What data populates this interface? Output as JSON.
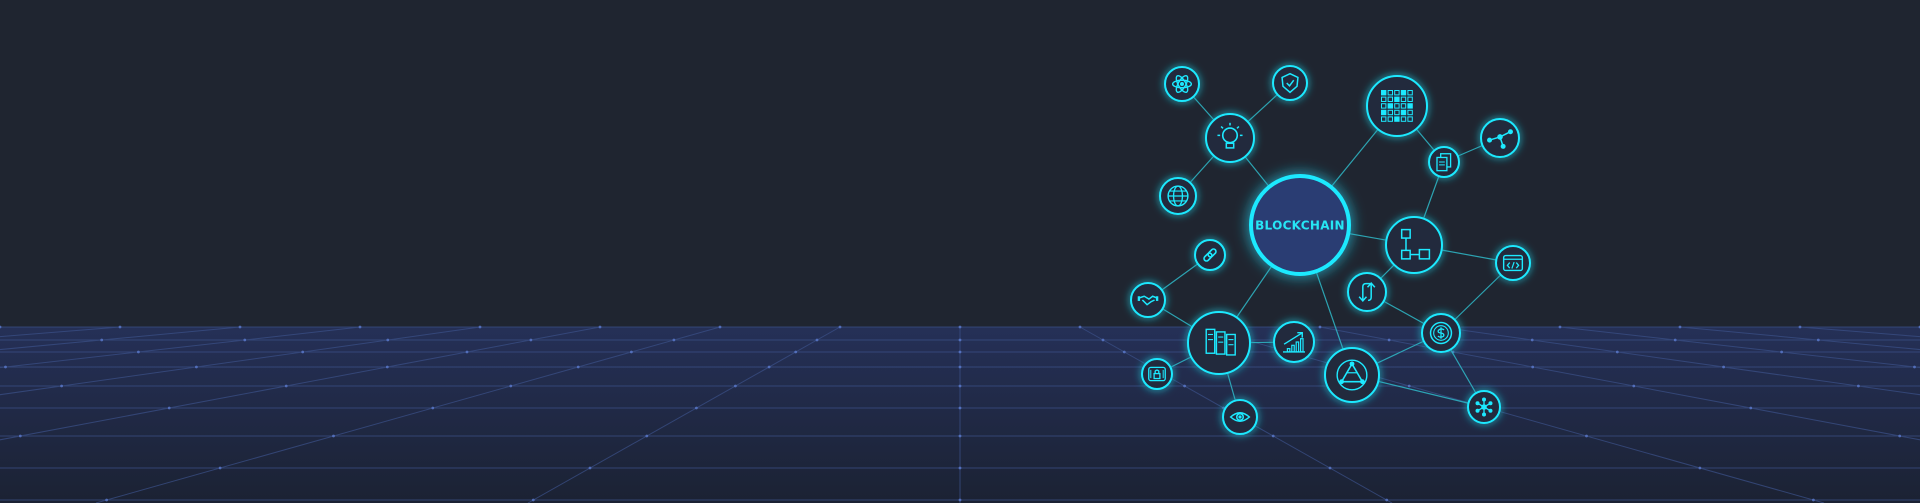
{
  "hub": {
    "label": "BLOCKCHAIN"
  },
  "colors": {
    "background": "#1f2530",
    "floor": "#1d2538",
    "grid_line": "#3a4f86",
    "grid_dot": "#5d7cd0",
    "accent": "#19d6e8",
    "accent_glow": "#00e5ff",
    "hub_fill": "#2b3c73",
    "node_fill": "#222b3d",
    "edge": "#2fb9c8"
  },
  "nodes": [
    {
      "id": "atom",
      "icon": "atom-icon"
    },
    {
      "id": "shield",
      "icon": "shield-check-icon"
    },
    {
      "id": "idea",
      "icon": "lightbulb-icon"
    },
    {
      "id": "globe",
      "icon": "globe-icon"
    },
    {
      "id": "qr",
      "icon": "qr-grid-icon"
    },
    {
      "id": "molecule",
      "icon": "molecule-icon"
    },
    {
      "id": "docs",
      "icon": "documents-icon"
    },
    {
      "id": "flow",
      "icon": "flowchart-icon"
    },
    {
      "id": "code",
      "icon": "code-window-icon"
    },
    {
      "id": "link",
      "icon": "link-icon"
    },
    {
      "id": "handshake",
      "icon": "handshake-icon"
    },
    {
      "id": "servers",
      "icon": "server-racks-icon"
    },
    {
      "id": "growth",
      "icon": "growth-chart-icon"
    },
    {
      "id": "sync",
      "icon": "sync-arrows-icon"
    },
    {
      "id": "coin",
      "icon": "coin-dollar-icon"
    },
    {
      "id": "triangle",
      "icon": "triangle-network-icon"
    },
    {
      "id": "lock",
      "icon": "lock-icon"
    },
    {
      "id": "eye",
      "icon": "eye-icon"
    },
    {
      "id": "hub",
      "icon": "hub-network-icon"
    }
  ]
}
